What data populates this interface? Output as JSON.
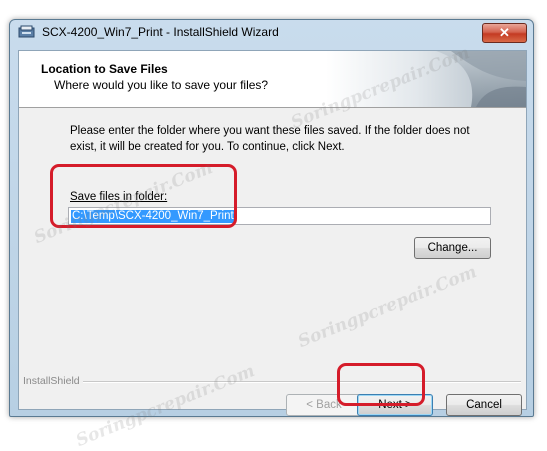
{
  "window": {
    "title": "SCX-4200_Win7_Print - InstallShield Wizard",
    "close_label": "✕"
  },
  "header": {
    "title": "Location to Save Files",
    "subtitle": "Where would you like to save your files?"
  },
  "body": {
    "instructions": "Please enter the folder where you want these files saved.  If the folder does not exist, it will be created for you.   To continue, click Next.",
    "folder_label": "Save files in folder:",
    "folder_value": "C:\\Temp\\SCX-4200_Win7_Print",
    "change_button": "Change..."
  },
  "footer": {
    "brand": "InstallShield",
    "back_button": "< Back",
    "next_button": "Next >",
    "cancel_button": "Cancel"
  },
  "watermark_text": "Soringpcrepair.Com",
  "colors": {
    "highlight": "#d51c2a",
    "selection": "#3399ff"
  }
}
